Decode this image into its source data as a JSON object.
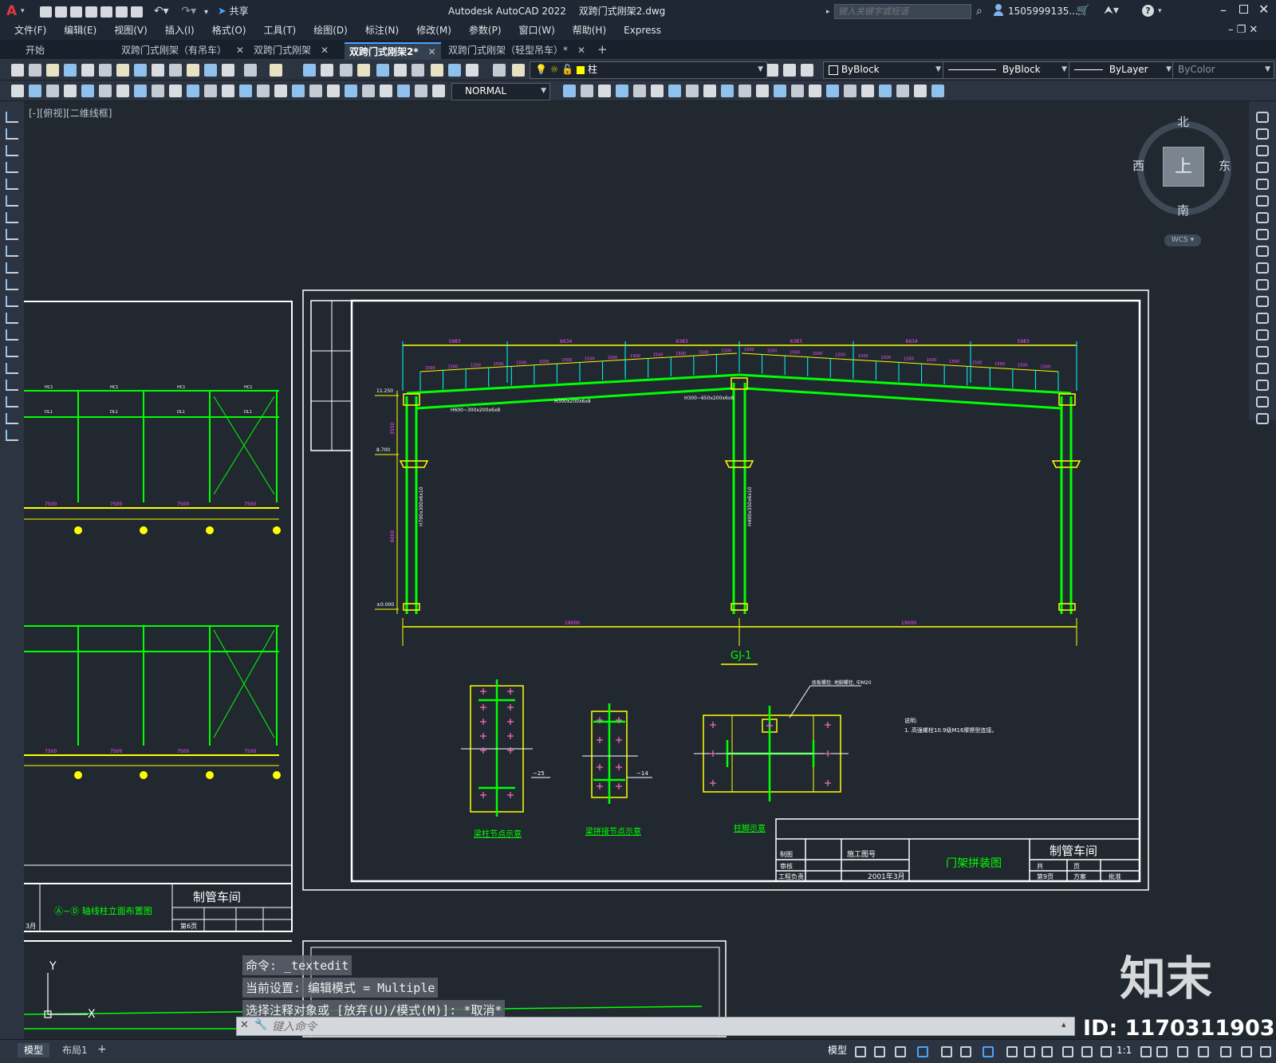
{
  "title_bar": {
    "app_title": "Autodesk AutoCAD 2022",
    "file_name": "双跨门式刚架2.dwg",
    "share_label": "共享",
    "search_placeholder": "键入关键字或短语",
    "user_name": "1505999135..."
  },
  "menu": [
    "文件(F)",
    "编辑(E)",
    "视图(V)",
    "插入(I)",
    "格式(O)",
    "工具(T)",
    "绘图(D)",
    "标注(N)",
    "修改(M)",
    "参数(P)",
    "窗口(W)",
    "帮助(H)",
    "Express"
  ],
  "tabs": [
    {
      "label": "开始",
      "active": false,
      "closable": false
    },
    {
      "label": "双跨门式刚架（有吊车）",
      "active": false,
      "closable": true
    },
    {
      "label": "双跨门式刚架",
      "active": false,
      "closable": true
    },
    {
      "label": "双跨门式刚架2*",
      "active": true,
      "closable": true
    },
    {
      "label": "双跨门式刚架（轻型吊车）*",
      "active": false,
      "closable": true
    }
  ],
  "properties": {
    "layer": "柱",
    "color": "ByBlock",
    "linetype": "ByBlock",
    "lineweight": "ByLayer",
    "plotstyle": "ByColor",
    "text_style": "NORMAL"
  },
  "viewport_label": "[-][俯视][二维线框]",
  "viewcube": {
    "north": "北",
    "south": "南",
    "east": "东",
    "west": "西",
    "face": "上",
    "wcs": "WCS"
  },
  "drawing": {
    "frame_label": "GJ-1",
    "top_dims": [
      "5983",
      "6634",
      "6383",
      "6383",
      "6634",
      "5983"
    ],
    "bottom_dims": [
      "19000",
      "19000"
    ],
    "purlin_dims": [
      "1500",
      "1500",
      "1500",
      "1500",
      "1500",
      "1500",
      "1500",
      "1500",
      "1500",
      "1500",
      "1500",
      "1500",
      "1500",
      "1500",
      "1500",
      "1500",
      "1500",
      "1500",
      "1500",
      "1500",
      "1500",
      "1500",
      "1500",
      "1500",
      "1500",
      "1500",
      "1500",
      "1500",
      "1500"
    ],
    "member_labels": [
      "H600~300x200x6x8",
      "H300x200x6x8",
      "H300~650x200x6x8",
      "H700x300x6x10",
      "H400x350x6x10"
    ],
    "level_labels": [
      "11.250",
      "8.700",
      "±0.000"
    ],
    "elev_labels": [
      "3550",
      "6000"
    ],
    "detail_labels": [
      "梁柱节点示意",
      "梁拼接节点示意",
      "柱脚示意"
    ],
    "plate_labels": [
      "−25",
      "−14"
    ],
    "bolt_note": "底板螺栓: 地脚螺栓, 中M20",
    "notes_title": "说明:",
    "notes_line": "1. 高强螺栓10.9级M16摩擦型连接。",
    "title_block": {
      "company": "制管车间",
      "drawing_title": "门架拼装图",
      "drawing_no": "施工图号",
      "date": "2001年3月",
      "sheet": "第9页",
      "roles": [
        "制图",
        "审核",
        "工程负责"
      ],
      "cols": [
        "共",
        "页",
        "方案",
        "批准"
      ]
    },
    "left_panel": {
      "title": "Ⓐ~Ⓓ 轴线柱立面布置图",
      "company": "制管车间",
      "sheet": "第6页",
      "labels": [
        "HC1",
        "HC1",
        "HC1",
        "HC1",
        "DL1",
        "DL1",
        "DL1",
        "DL1"
      ],
      "spans": [
        "7500",
        "7500",
        "7500",
        "7500"
      ],
      "date": "3月"
    }
  },
  "command_history": [
    "命令:  _textedit",
    "当前设置: 编辑模式 = Multiple",
    "选择注释对象或 [放弃(U)/模式(M)]: *取消*"
  ],
  "command_placeholder": "键入命令",
  "layout_tabs": [
    {
      "label": "模型",
      "active": true
    },
    {
      "label": "布局1",
      "active": false
    }
  ],
  "status": {
    "model": "模型",
    "scale": "1:1"
  },
  "watermark": {
    "brand": "知末",
    "id": "ID: 1170311903"
  }
}
